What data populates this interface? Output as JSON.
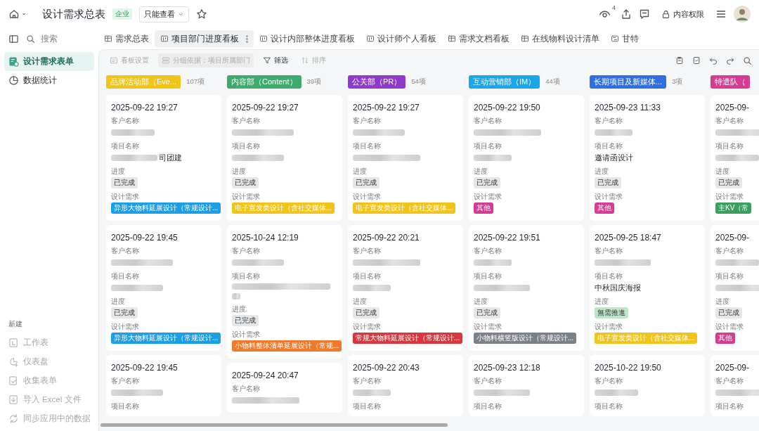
{
  "top_bar": {
    "title": "设计需求总表",
    "badge": "企业",
    "view_mode": "只能查看",
    "viewer_count": "4",
    "permission": "内容权限"
  },
  "sidebar": {
    "search_placeholder": "搜索",
    "items": [
      {
        "label": "设计需求表单",
        "kind": "form",
        "selected": true
      },
      {
        "label": "数据统计",
        "kind": "chart",
        "selected": false
      }
    ],
    "new_heading": "新建",
    "new_items": [
      {
        "label": "工作表",
        "kind": "sheet",
        "disabled": true
      },
      {
        "label": "仪表盘",
        "kind": "dashboard",
        "disabled": true
      },
      {
        "label": "收集表单",
        "kind": "form",
        "disabled": true
      },
      {
        "label": "导入 Excel 文件",
        "kind": "import",
        "disabled": true
      },
      {
        "label": "同步应用中的数据",
        "kind": "sync",
        "disabled": true
      }
    ]
  },
  "tabs": [
    {
      "label": "需求总表",
      "kind": "table",
      "selected": false
    },
    {
      "label": "项目部门进度看板",
      "kind": "kanban",
      "selected": true
    },
    {
      "label": "设计内部整体进度看板",
      "kind": "kanban",
      "selected": false
    },
    {
      "label": "设计师个人看板",
      "kind": "kanban",
      "selected": false
    },
    {
      "label": "需求文档看板",
      "kind": "table",
      "selected": false
    },
    {
      "label": "在线物料设计清单",
      "kind": "table",
      "selected": false
    },
    {
      "label": "甘特",
      "kind": "gantt",
      "selected": false
    }
  ],
  "toolbar": [
    {
      "label": "看板设置",
      "kind": "settings",
      "disabled": true
    },
    {
      "label": "分组依据：项目所属部门",
      "kind": "group",
      "disabled": true
    },
    {
      "label": "筛选",
      "kind": "filter",
      "disabled": false
    },
    {
      "label": "排序",
      "kind": "sort",
      "disabled": true
    }
  ],
  "columns": [
    {
      "label": "品牌活动部（Eve...",
      "count": "107项",
      "color": "#f0c419",
      "cards": [
        {
          "time": "2025-09-22 19:27",
          "fields": [
            {
              "label": "客户名称",
              "kind": "blur"
            },
            {
              "label": "项目名称",
              "kind": "blur",
              "text": "司团建"
            },
            {
              "label": "进度",
              "kind": "tag",
              "text": "已完成",
              "color": "#e5e6e8"
            },
            {
              "label": "设计需求",
              "kind": "tag",
              "text": "异形大物料延展设计（常规设计...",
              "color": "#1a9fe6"
            }
          ]
        },
        {
          "time": "2025-09-22 19:45",
          "fields": [
            {
              "label": "客户名称",
              "kind": "blur"
            },
            {
              "label": "项目名称",
              "kind": "blur"
            },
            {
              "label": "进度",
              "kind": "tag",
              "text": "已完成",
              "color": "#e5e6e8"
            },
            {
              "label": "设计需求",
              "kind": "tag",
              "text": "异形大物料延展设计（常规设计...",
              "color": "#1a9fe6"
            }
          ]
        },
        {
          "time": "2025-09-22 19:45",
          "fields": [
            {
              "label": "客户名称",
              "kind": "blur"
            },
            {
              "label": "项目名称"
            }
          ]
        }
      ]
    },
    {
      "label": "内容部（Content）",
      "count": "39项",
      "color": "#3dab6b",
      "cards": [
        {
          "time": "2025-09-22 19:27",
          "fields": [
            {
              "label": "客户名称",
              "kind": "blur"
            },
            {
              "label": "项目名称",
              "kind": "blur"
            },
            {
              "label": "进度",
              "kind": "tag",
              "text": "已完成",
              "color": "#e5e6e8"
            },
            {
              "label": "设计需求",
              "kind": "tag",
              "text": "电子宣发类设计（含社交媒体...",
              "color": "#f0c419"
            }
          ]
        },
        {
          "time": "2025-10-24 12:19",
          "fields": [
            {
              "label": "客户名称",
              "kind": "blur"
            },
            {
              "label": "项目名称",
              "kind": "blur_multiline"
            },
            {
              "label": "进度",
              "kind": "tag",
              "text": "已完成",
              "color": "#e5e6e8"
            },
            {
              "label": "设计需求",
              "kind": "tag",
              "text": "小物料整体清单延展设计（常规...",
              "color": "#f0792a"
            }
          ]
        },
        {
          "time": "2025-09-24 20:47",
          "fields": [
            {
              "label": "客户名称",
              "kind": "blur"
            }
          ]
        }
      ]
    },
    {
      "label": "公关部（PR）",
      "count": "54项",
      "color": "#8e3bcb",
      "cards": [
        {
          "time": "2025-09-22 19:27",
          "fields": [
            {
              "label": "客户名称",
              "kind": "blur"
            },
            {
              "label": "项目名称",
              "kind": "blur"
            },
            {
              "label": "进度",
              "kind": "tag",
              "text": "已完成",
              "color": "#e5e6e8"
            },
            {
              "label": "设计需求",
              "kind": "tag",
              "text": "电子宣发类设计（含社交媒体...",
              "color": "#f0c419"
            }
          ]
        },
        {
          "time": "2025-09-22 20:21",
          "fields": [
            {
              "label": "客户名称",
              "kind": "blur"
            },
            {
              "label": "项目名称",
              "kind": "blur"
            },
            {
              "label": "进度",
              "kind": "tag",
              "text": "已完成",
              "color": "#e5e6e8"
            },
            {
              "label": "设计需求",
              "kind": "tag",
              "text": "常规大物料延展设计（常规设计...",
              "color": "#d9363e"
            }
          ]
        },
        {
          "time": "2025-09-22 20:43",
          "fields": [
            {
              "label": "客户名称",
              "kind": "blur"
            },
            {
              "label": "项目名称"
            }
          ]
        }
      ]
    },
    {
      "label": "互动营销部（IM）",
      "count": "44项",
      "color": "#1aa6ea",
      "cards": [
        {
          "time": "2025-09-22 19:50",
          "fields": [
            {
              "label": "客户名称",
              "kind": "blur"
            },
            {
              "label": "项目名称",
              "kind": "blur"
            },
            {
              "label": "进度",
              "kind": "tag",
              "text": "已完成",
              "color": "#e5e6e8"
            },
            {
              "label": "设计需求",
              "kind": "tag",
              "text": "其他",
              "color": "#d63d92"
            }
          ]
        },
        {
          "time": "2025-09-22 19:51",
          "fields": [
            {
              "label": "客户名称",
              "kind": "blur"
            },
            {
              "label": "项目名称",
              "kind": "blur"
            },
            {
              "label": "进度",
              "kind": "tag",
              "text": "已完成",
              "color": "#e5e6e8"
            },
            {
              "label": "设计需求",
              "kind": "tag",
              "text": "小物料横竖版设计（常规设计...",
              "color": "#7c8187"
            }
          ]
        },
        {
          "time": "2025-09-23 12:18",
          "fields": [
            {
              "label": "客户名称",
              "kind": "blur"
            },
            {
              "label": "项目名称"
            }
          ]
        }
      ]
    },
    {
      "label": "长期项目及新媒体...",
      "count": "3项",
      "color": "#2f6fe0",
      "cards": [
        {
          "time": "2025-09-23 11:33",
          "fields": [
            {
              "label": "客户名称",
              "kind": "blur"
            },
            {
              "label": "项目名称",
              "kind": "text",
              "text": "邀请函设计"
            },
            {
              "label": "进度",
              "kind": "tag",
              "text": "已完成",
              "color": "#e5e6e8"
            },
            {
              "label": "设计需求",
              "kind": "tag",
              "text": "其他",
              "color": "#d63d92"
            }
          ]
        },
        {
          "time": "2025-09-25 18:47",
          "fields": [
            {
              "label": "客户名称",
              "kind": "blur"
            },
            {
              "label": "项目名称",
              "kind": "text",
              "text": "中秋国庆海报"
            },
            {
              "label": "进度",
              "kind": "tag",
              "text": "無需推進",
              "color": "#bde6c9"
            },
            {
              "label": "设计需求",
              "kind": "tag",
              "text": "电子宣发类设计（含社交媒体...",
              "color": "#f0c419"
            }
          ]
        },
        {
          "time": "2025-10-22 19:50",
          "fields": [
            {
              "label": "客户名称",
              "kind": "blur"
            },
            {
              "label": "项目名称"
            }
          ]
        }
      ]
    },
    {
      "label": "特遣队（",
      "color": "#d63d92",
      "cards": [
        {
          "time": "2025-09-",
          "fields": [
            {
              "label": "客户名称",
              "kind": "blur"
            },
            {
              "label": "项目名称",
              "kind": "blur"
            },
            {
              "label": "进度",
              "kind": "tag",
              "text": "已完成",
              "color": "#e5e6e8"
            },
            {
              "label": "设计需求",
              "kind": "tag",
              "text": "主KV（常",
              "color": "#3a9e5f"
            }
          ]
        },
        {
          "time": "2025-09-",
          "fields": [
            {
              "label": "客户名称",
              "kind": "blur"
            },
            {
              "label": "项目名称",
              "kind": "blur"
            },
            {
              "label": "进度",
              "kind": "tag",
              "text": "已完成",
              "color": "#e5e6e8"
            },
            {
              "label": "设计需求",
              "kind": "tag",
              "text": "其他",
              "color": "#d63d92"
            }
          ]
        },
        {
          "time": "2025-09-",
          "fields": [
            {
              "label": "客户名称",
              "kind": "blur"
            },
            {
              "label": "项目名称"
            }
          ]
        }
      ]
    }
  ]
}
